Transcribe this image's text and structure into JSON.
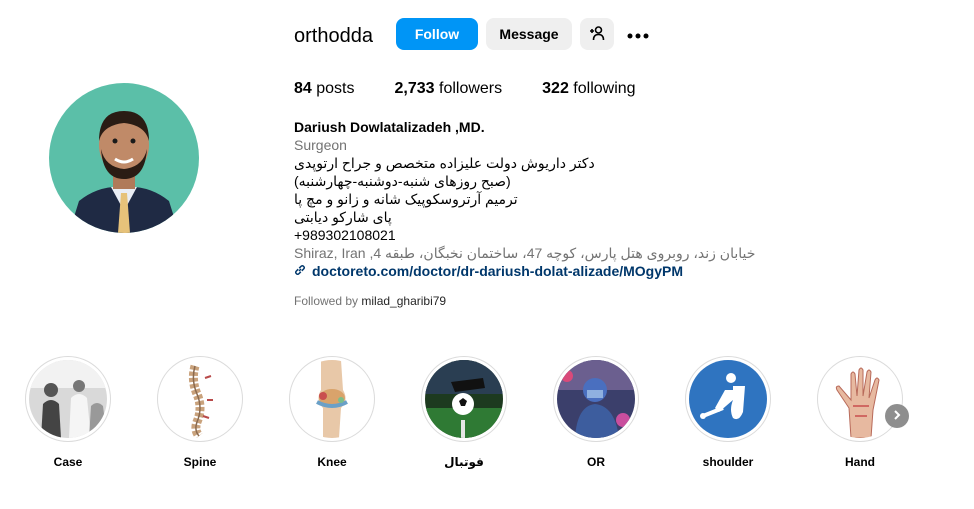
{
  "profile": {
    "username": "orthodda",
    "follow_label": "Follow",
    "message_label": "Message",
    "stats": {
      "posts_count": "84",
      "posts_label": "posts",
      "followers_count": "2,733",
      "followers_label": "followers",
      "following_count": "322",
      "following_label": "following"
    },
    "bio": {
      "name": "Dariush Dowlatalizadeh ,MD.",
      "category": "Surgeon",
      "lines": [
        "دکتر داریوش دولت علیزاده متخصص و جراح ارتوپدی",
        "(صبح روزهای شنبه-دوشنبه-چهارشنبه)",
        "ترمیم آرتروسکوپیک شانه و زانو و مچ پا",
        "پای شارکو دیابتی",
        "+989302108021"
      ],
      "address": "خیابان زند، روبروی هتل پارس، کوچه 47، ساختمان نخبگان، طبقه 4, Shiraz, Iran",
      "link": "doctoreto.com/doctor/dr-dariush-dolat-alizade/MOgyPM"
    },
    "followed_by_prefix": "Followed by",
    "followed_by_user": "milad_gharibi79"
  },
  "highlights": [
    {
      "label": "Case",
      "icon": "case-photo"
    },
    {
      "label": "Spine",
      "icon": "spine-illustration"
    },
    {
      "label": "Knee",
      "icon": "knee-illustration"
    },
    {
      "label": "فوتبال",
      "icon": "football-photo"
    },
    {
      "label": "OR",
      "icon": "operating-room-photo"
    },
    {
      "label": "shoulder",
      "icon": "shoulder-icon"
    },
    {
      "label": "Hand",
      "icon": "hand-illustration"
    }
  ],
  "colors": {
    "accent": "#0095f6",
    "secondary_button": "#efefef",
    "muted_text": "#737373",
    "link": "#00376b",
    "avatar_bg": "#5bbfa8",
    "shoulder_bg": "#2f74c0"
  }
}
